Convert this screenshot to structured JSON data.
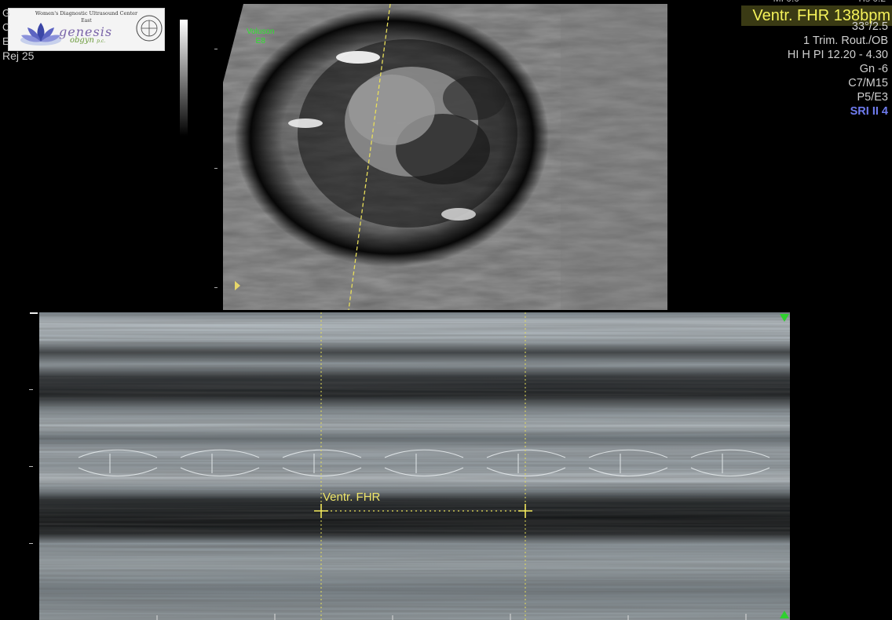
{
  "logo": {
    "tagline": "Women's Diagnostic Ultrasound Center",
    "location": "East",
    "brand_main": "genesis",
    "brand_sub": "obgyn",
    "brand_suffix": "p.c."
  },
  "left_labels": {
    "line1": "G",
    "line2": "C",
    "line3": "E",
    "rej": "Rej  25"
  },
  "probe_overlay": {
    "brand": "Voluson",
    "model": "E8"
  },
  "measurement": {
    "headline": "Ventr. FHR 138bpm",
    "cursor_label": "Ventr. FHR"
  },
  "settings": [
    "33°/2.5",
    "1 Trim. Rout./OB",
    "HI H PI 12.20 - 4.30",
    "Gn  -6",
    "C7/M15",
    "P5/E3"
  ],
  "sri": "SRI II 4",
  "colors": {
    "measurement_text": "#f5f25a",
    "sri_text": "#6f7cf0",
    "marker_green": "#2fd02f",
    "probe_label": "#2fe02f",
    "background": "#000000"
  },
  "icons": [
    "lotus-logo-icon",
    "accreditation-seal-icon",
    "focus-marker-icon",
    "m-line-top-icon",
    "m-line-bottom-icon",
    "caliper-cross-icon"
  ]
}
